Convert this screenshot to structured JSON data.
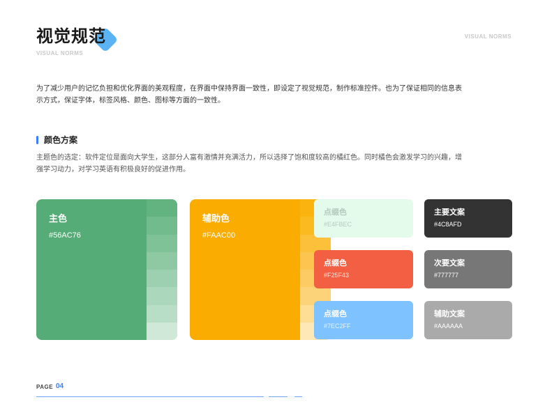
{
  "header": {
    "title": "视觉规范",
    "subtitle_en": "VISUAL NORMS",
    "corner_en": "VISUAL NORMS"
  },
  "intro": "为了减少用户的记忆负担和优化界面的美观程度，在界面中保持界面一致性，即设定了视觉规范，制作标准控件。也为了保证相同的信息表示方式，保证字体，标签风格、颜色、图标等方面的一致性。",
  "section": {
    "title": "颜色方案",
    "description": "主题色的选定：软件定位是面向大学生，这部分人富有激情并充满活力，所以选择了饱和度较高的橘红色。同时橘色会激发学习的兴趣，增强学习动力，对学习英语有积极良好的促进作用。"
  },
  "colors": {
    "primary": {
      "name": "主色",
      "hex": "#56AC76",
      "shades": [
        "#63b381",
        "#72bb8d",
        "#80c298",
        "#8ec9a4",
        "#9dd0b0",
        "#abd7bc",
        "#b9dec7",
        "#cfe8d8"
      ]
    },
    "secondary": {
      "name": "辅助色",
      "hex": "#FAAC00",
      "shades": [
        "#fbb40f",
        "#fbba1f",
        "#fcc03b",
        "#fcc550",
        "#fdcb63",
        "#fdd37a",
        "#fedd95",
        "#fee8b5"
      ]
    },
    "accents": [
      {
        "name": "点缀色",
        "hex": "#E4FBEC"
      },
      {
        "name": "点缀色",
        "hex": "#F25F43"
      },
      {
        "name": "点缀色",
        "hex": "#7EC2FF"
      }
    ],
    "text": [
      {
        "name": "主要文案",
        "hex": "#4C8AFD",
        "bg": "#333333"
      },
      {
        "name": "次要文案",
        "hex": "#777777",
        "bg": "#777777"
      },
      {
        "name": "辅助文案",
        "hex": "#AAAAAA",
        "bg": "#aaaaaa"
      }
    ]
  },
  "footer": {
    "page_label": "PAGE",
    "page_number": "04"
  }
}
